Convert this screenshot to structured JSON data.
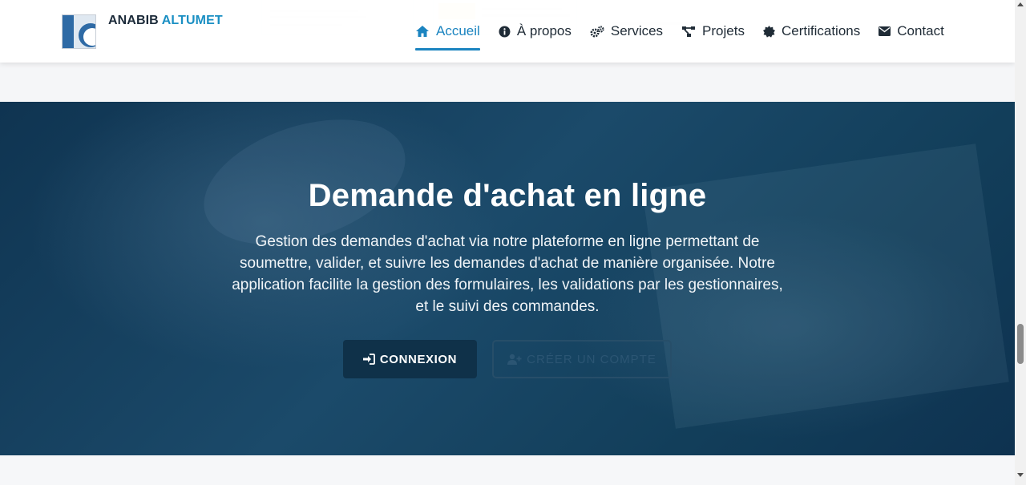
{
  "brand": {
    "name_part1": "ANABIB",
    "name_part2": "ALTUMET"
  },
  "nav": {
    "items": [
      {
        "label": "Accueil",
        "icon": "home-icon",
        "active": true
      },
      {
        "label": "À propos",
        "icon": "info-circle-icon",
        "active": false
      },
      {
        "label": "Services",
        "icon": "cogs-icon",
        "active": false
      },
      {
        "label": "Projets",
        "icon": "project-diagram-icon",
        "active": false
      },
      {
        "label": "Certifications",
        "icon": "certificate-icon",
        "active": false
      },
      {
        "label": "Contact",
        "icon": "envelope-icon",
        "active": false
      }
    ]
  },
  "hero": {
    "title": "Demande d'achat en ligne",
    "description": "Gestion des demandes d'achat via notre plateforme en ligne permettant de soumettre, valider, et suivre les demandes d'achat de manière organisée. Notre application facilite la gestion des formulaires, les validations par les gestionnaires, et le suivi des commandes.",
    "connect_label": "CONNEXION",
    "create_label": "CRÉER UN COMPTE"
  },
  "colors": {
    "accent": "#1b84c0",
    "hero_bg": "#123e5a",
    "button_dark": "#0f3149"
  }
}
